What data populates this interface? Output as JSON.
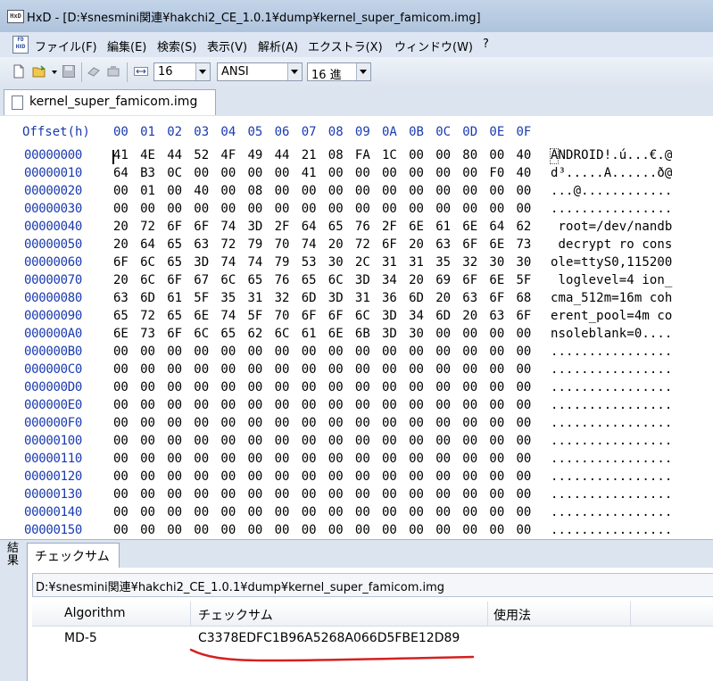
{
  "window": {
    "title": "HxD - [D:¥snesmini関連¥hakchi2_CE_1.0.1¥dump¥kernel_super_famicom.img]"
  },
  "menu": [
    "ファイル(F)",
    "編集(E)",
    "検索(S)",
    "表示(V)",
    "解析(A)",
    "エクストラ(X)",
    "ウィンドウ(W)",
    "?"
  ],
  "toolbar": {
    "bytes_per_row": "16",
    "charset": "ANSI",
    "offset_base": "16 進"
  },
  "tab": {
    "label": "kernel_super_famicom.img"
  },
  "hex": {
    "offset_header": "Offset(h)",
    "columns": [
      "00",
      "01",
      "02",
      "03",
      "04",
      "05",
      "06",
      "07",
      "08",
      "09",
      "0A",
      "0B",
      "0C",
      "0D",
      "0E",
      "0F"
    ],
    "rows": [
      {
        "offset": "00000000",
        "bytes": [
          "41",
          "4E",
          "44",
          "52",
          "4F",
          "49",
          "44",
          "21",
          "08",
          "FA",
          "1C",
          "00",
          "00",
          "80",
          "00",
          "40"
        ],
        "ascii": "ANDROID!.ú...€.@"
      },
      {
        "offset": "00000010",
        "bytes": [
          "64",
          "B3",
          "0C",
          "00",
          "00",
          "00",
          "00",
          "41",
          "00",
          "00",
          "00",
          "00",
          "00",
          "00",
          "F0",
          "40"
        ],
        "ascii": "d³.....A......ð@"
      },
      {
        "offset": "00000020",
        "bytes": [
          "00",
          "01",
          "00",
          "40",
          "00",
          "08",
          "00",
          "00",
          "00",
          "00",
          "00",
          "00",
          "00",
          "00",
          "00",
          "00"
        ],
        "ascii": "...@............"
      },
      {
        "offset": "00000030",
        "bytes": [
          "00",
          "00",
          "00",
          "00",
          "00",
          "00",
          "00",
          "00",
          "00",
          "00",
          "00",
          "00",
          "00",
          "00",
          "00",
          "00"
        ],
        "ascii": "................"
      },
      {
        "offset": "00000040",
        "bytes": [
          "20",
          "72",
          "6F",
          "6F",
          "74",
          "3D",
          "2F",
          "64",
          "65",
          "76",
          "2F",
          "6E",
          "61",
          "6E",
          "64",
          "62"
        ],
        "ascii": " root=/dev/nandb"
      },
      {
        "offset": "00000050",
        "bytes": [
          "20",
          "64",
          "65",
          "63",
          "72",
          "79",
          "70",
          "74",
          "20",
          "72",
          "6F",
          "20",
          "63",
          "6F",
          "6E",
          "73"
        ],
        "ascii": " decrypt ro cons"
      },
      {
        "offset": "00000060",
        "bytes": [
          "6F",
          "6C",
          "65",
          "3D",
          "74",
          "74",
          "79",
          "53",
          "30",
          "2C",
          "31",
          "31",
          "35",
          "32",
          "30",
          "30"
        ],
        "ascii": "ole=ttyS0,115200"
      },
      {
        "offset": "00000070",
        "bytes": [
          "20",
          "6C",
          "6F",
          "67",
          "6C",
          "65",
          "76",
          "65",
          "6C",
          "3D",
          "34",
          "20",
          "69",
          "6F",
          "6E",
          "5F"
        ],
        "ascii": " loglevel=4 ion_"
      },
      {
        "offset": "00000080",
        "bytes": [
          "63",
          "6D",
          "61",
          "5F",
          "35",
          "31",
          "32",
          "6D",
          "3D",
          "31",
          "36",
          "6D",
          "20",
          "63",
          "6F",
          "68"
        ],
        "ascii": "cma_512m=16m coh"
      },
      {
        "offset": "00000090",
        "bytes": [
          "65",
          "72",
          "65",
          "6E",
          "74",
          "5F",
          "70",
          "6F",
          "6F",
          "6C",
          "3D",
          "34",
          "6D",
          "20",
          "63",
          "6F"
        ],
        "ascii": "erent_pool=4m co"
      },
      {
        "offset": "000000A0",
        "bytes": [
          "6E",
          "73",
          "6F",
          "6C",
          "65",
          "62",
          "6C",
          "61",
          "6E",
          "6B",
          "3D",
          "30",
          "00",
          "00",
          "00",
          "00"
        ],
        "ascii": "nsoleblank=0...."
      },
      {
        "offset": "000000B0",
        "bytes": [
          "00",
          "00",
          "00",
          "00",
          "00",
          "00",
          "00",
          "00",
          "00",
          "00",
          "00",
          "00",
          "00",
          "00",
          "00",
          "00"
        ],
        "ascii": "................"
      },
      {
        "offset": "000000C0",
        "bytes": [
          "00",
          "00",
          "00",
          "00",
          "00",
          "00",
          "00",
          "00",
          "00",
          "00",
          "00",
          "00",
          "00",
          "00",
          "00",
          "00"
        ],
        "ascii": "................"
      },
      {
        "offset": "000000D0",
        "bytes": [
          "00",
          "00",
          "00",
          "00",
          "00",
          "00",
          "00",
          "00",
          "00",
          "00",
          "00",
          "00",
          "00",
          "00",
          "00",
          "00"
        ],
        "ascii": "................"
      },
      {
        "offset": "000000E0",
        "bytes": [
          "00",
          "00",
          "00",
          "00",
          "00",
          "00",
          "00",
          "00",
          "00",
          "00",
          "00",
          "00",
          "00",
          "00",
          "00",
          "00"
        ],
        "ascii": "................"
      },
      {
        "offset": "000000F0",
        "bytes": [
          "00",
          "00",
          "00",
          "00",
          "00",
          "00",
          "00",
          "00",
          "00",
          "00",
          "00",
          "00",
          "00",
          "00",
          "00",
          "00"
        ],
        "ascii": "................"
      },
      {
        "offset": "00000100",
        "bytes": [
          "00",
          "00",
          "00",
          "00",
          "00",
          "00",
          "00",
          "00",
          "00",
          "00",
          "00",
          "00",
          "00",
          "00",
          "00",
          "00"
        ],
        "ascii": "................"
      },
      {
        "offset": "00000110",
        "bytes": [
          "00",
          "00",
          "00",
          "00",
          "00",
          "00",
          "00",
          "00",
          "00",
          "00",
          "00",
          "00",
          "00",
          "00",
          "00",
          "00"
        ],
        "ascii": "................"
      },
      {
        "offset": "00000120",
        "bytes": [
          "00",
          "00",
          "00",
          "00",
          "00",
          "00",
          "00",
          "00",
          "00",
          "00",
          "00",
          "00",
          "00",
          "00",
          "00",
          "00"
        ],
        "ascii": "................"
      },
      {
        "offset": "00000130",
        "bytes": [
          "00",
          "00",
          "00",
          "00",
          "00",
          "00",
          "00",
          "00",
          "00",
          "00",
          "00",
          "00",
          "00",
          "00",
          "00",
          "00"
        ],
        "ascii": "................"
      },
      {
        "offset": "00000140",
        "bytes": [
          "00",
          "00",
          "00",
          "00",
          "00",
          "00",
          "00",
          "00",
          "00",
          "00",
          "00",
          "00",
          "00",
          "00",
          "00",
          "00"
        ],
        "ascii": "................"
      },
      {
        "offset": "00000150",
        "bytes": [
          "00",
          "00",
          "00",
          "00",
          "00",
          "00",
          "00",
          "00",
          "00",
          "00",
          "00",
          "00",
          "00",
          "00",
          "00",
          "00"
        ],
        "ascii": "................"
      }
    ]
  },
  "results": {
    "side_label": "結果",
    "tab_label": "チェックサム",
    "file_path": "D:¥snesmini関連¥hakchi2_CE_1.0.1¥dump¥kernel_super_famicom.img",
    "columns": [
      "Algorithm",
      "チェックサム",
      "使用法"
    ],
    "rows": [
      {
        "algorithm": "MD-5",
        "checksum": "C3378EDFC1B96A5268A066D5FBE12D89",
        "usage": ""
      }
    ]
  },
  "colors": {
    "offset_blue": "#1a3ab0",
    "annotation_red": "#d42020"
  }
}
